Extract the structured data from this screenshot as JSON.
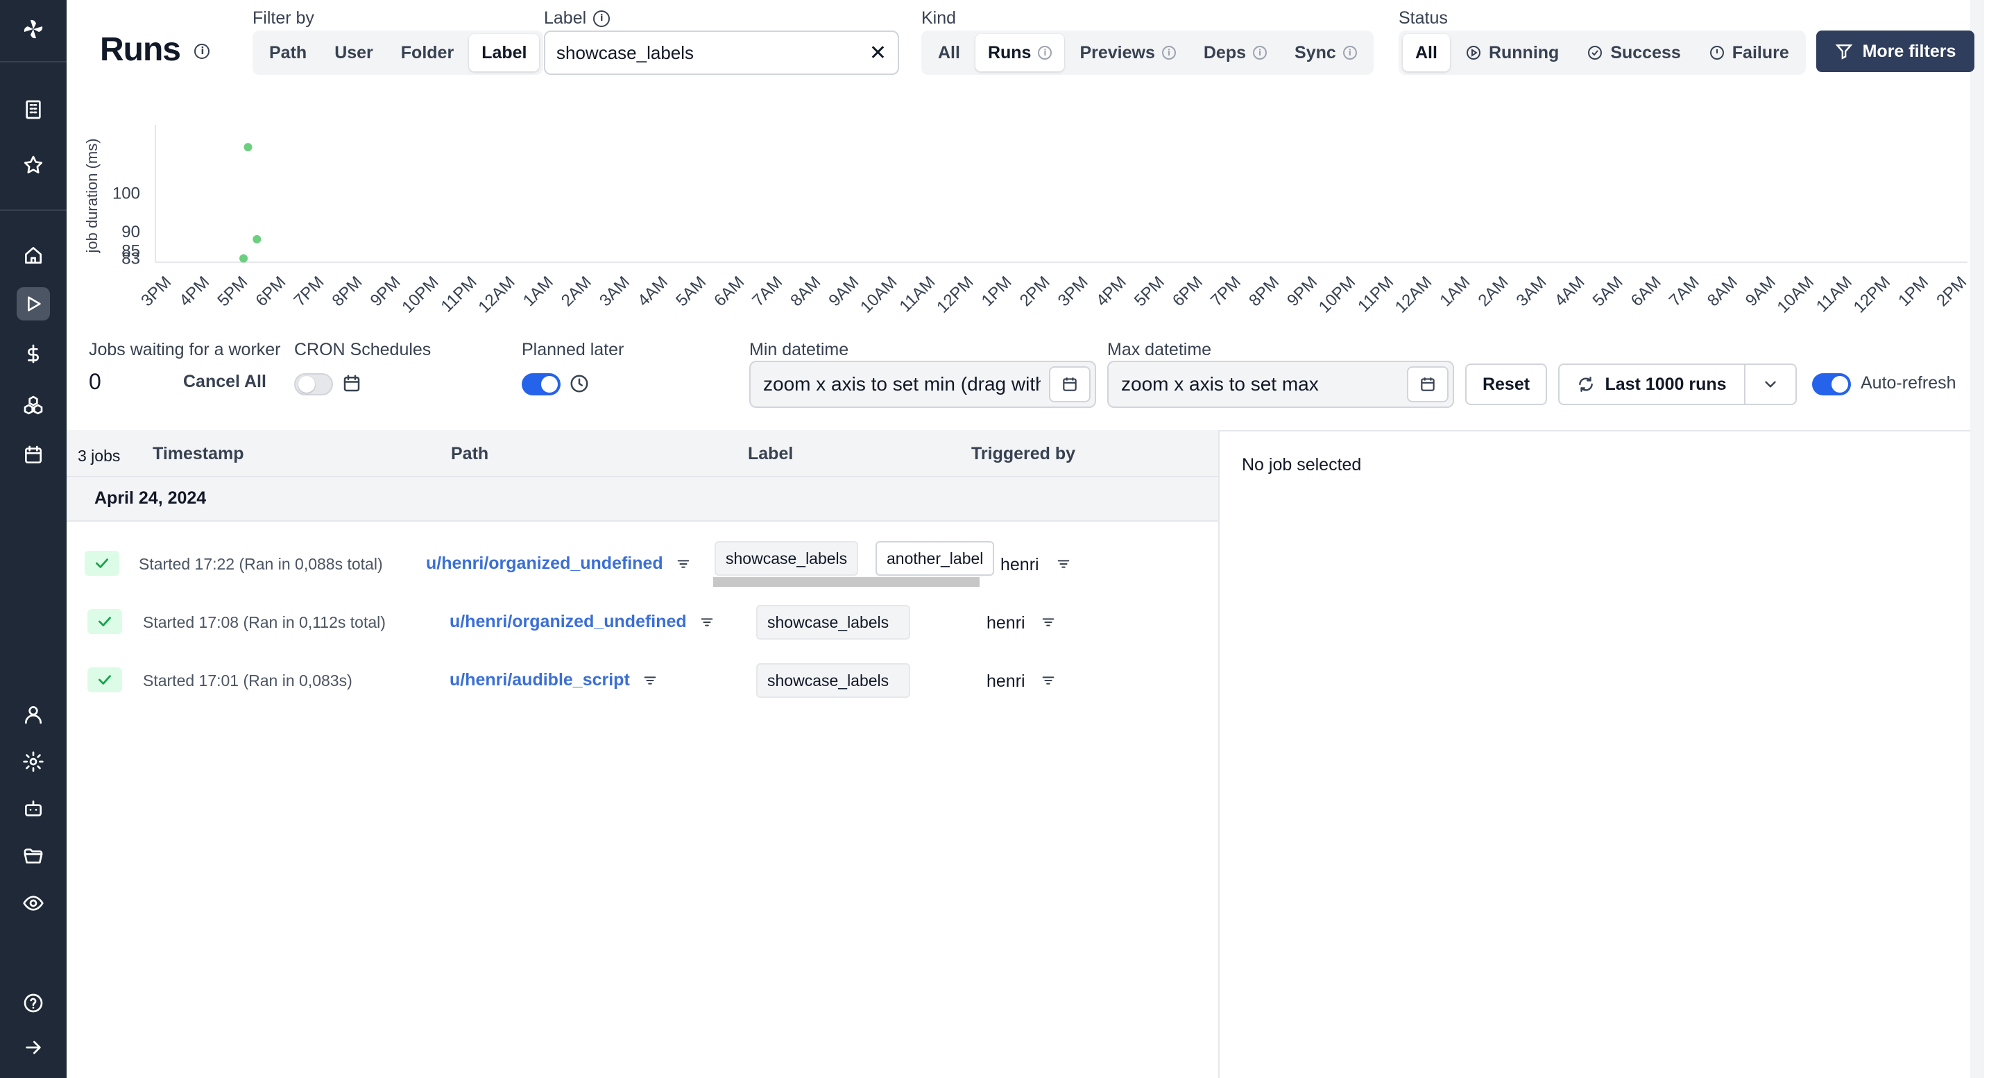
{
  "page": {
    "title": "Runs"
  },
  "filters": {
    "filter_by_label": "Filter by",
    "filter_by_options": [
      "Path",
      "User",
      "Folder",
      "Label"
    ],
    "filter_by_selected": "Label",
    "label_field_label": "Label",
    "label_value": "showcase_labels",
    "clear_symbol": "✕",
    "kind_label": "Kind",
    "kind_options": [
      "All",
      "Runs",
      "Previews",
      "Deps",
      "Sync"
    ],
    "kind_selected": "Runs",
    "status_label": "Status",
    "status_options": [
      "All",
      "Running",
      "Success",
      "Failure"
    ],
    "status_selected": "All",
    "more_filters_label": "More filters"
  },
  "chart_data": {
    "type": "scatter",
    "ylabel": "job duration (ms)",
    "y_ticks": [
      83,
      85,
      90,
      100
    ],
    "x_ticks": [
      "3PM",
      "4PM",
      "5PM",
      "6PM",
      "7PM",
      "8PM",
      "9PM",
      "10PM",
      "11PM",
      "12AM",
      "1AM",
      "2AM",
      "3AM",
      "4AM",
      "5AM",
      "6AM",
      "7AM",
      "8AM",
      "9AM",
      "10AM",
      "11AM",
      "12PM",
      "1PM",
      "2PM",
      "3PM",
      "4PM",
      "5PM",
      "6PM",
      "7PM",
      "8PM",
      "9PM",
      "10PM",
      "11PM",
      "12AM",
      "1AM",
      "2AM",
      "3AM",
      "4AM",
      "5AM",
      "6AM",
      "7AM",
      "8AM",
      "9AM",
      "10AM",
      "11AM",
      "12PM",
      "1PM",
      "2PM"
    ],
    "points": [
      {
        "time": "17:01",
        "y": 83
      },
      {
        "time": "17:08",
        "y": 112
      },
      {
        "time": "17:22",
        "y": 88
      }
    ],
    "point_color": "#6ccf7f"
  },
  "stats": {
    "jobs_waiting_label": "Jobs waiting for a worker",
    "jobs_waiting_value": "0",
    "cancel_all_label": "Cancel All",
    "cron_label": "CRON Schedules",
    "planned_later_label": "Planned later",
    "min_datetime_label": "Min datetime",
    "min_datetime_placeholder": "zoom x axis to set min (drag with ctrl)",
    "max_datetime_label": "Max datetime",
    "max_datetime_placeholder": "zoom x axis to set max",
    "reset_label": "Reset",
    "last_runs_label": "Last 1000 runs",
    "auto_refresh_label": "Auto-refresh"
  },
  "table": {
    "jobs_count": "3 jobs",
    "headers": {
      "timestamp": "Timestamp",
      "path": "Path",
      "label": "Label",
      "triggered_by": "Triggered by"
    },
    "date_group": "April 24, 2024",
    "rows": [
      {
        "timestamp": "Started 17:22 (Ran in 0,088s total)",
        "path": "u/henri/organized_undefined",
        "labels": [
          "showcase_labels",
          "another_label"
        ],
        "user": "henri"
      },
      {
        "timestamp": "Started 17:08 (Ran in 0,112s total)",
        "path": "u/henri/organized_undefined",
        "labels": [
          "showcase_labels"
        ],
        "user": "henri"
      },
      {
        "timestamp": "Started 17:01 (Ran in 0,083s)",
        "path": "u/henri/audible_script",
        "labels": [
          "showcase_labels"
        ],
        "user": "henri"
      }
    ]
  },
  "detail": {
    "empty_text": "No job selected"
  }
}
